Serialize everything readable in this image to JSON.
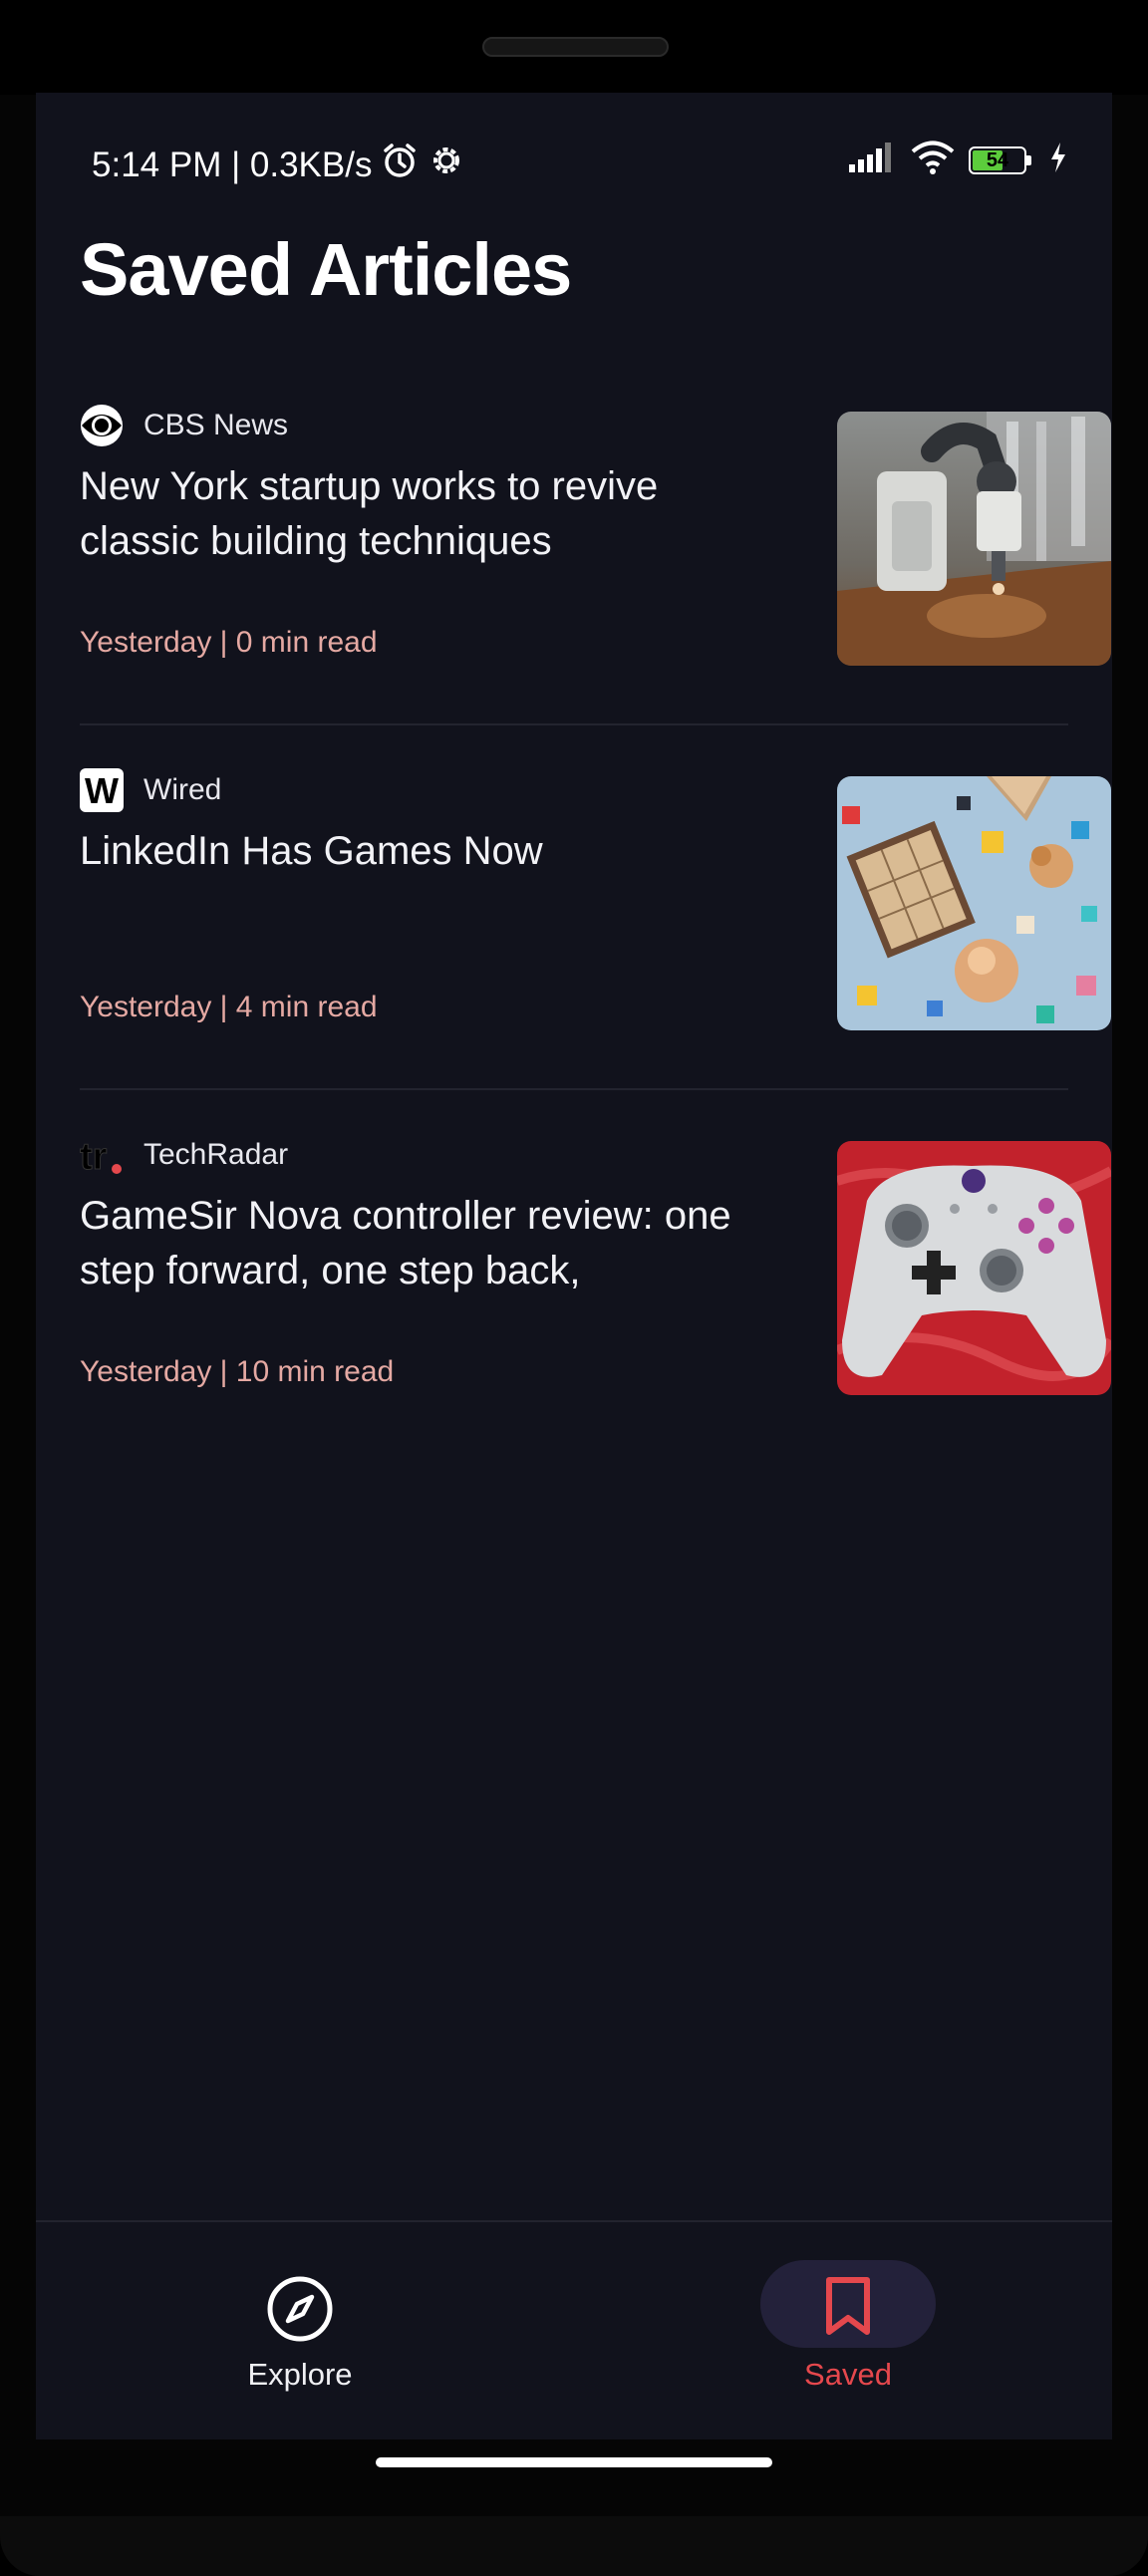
{
  "status_bar": {
    "time_speed": "5:14 PM | 0.3KB/s",
    "battery": "54"
  },
  "page_title": "Saved Articles",
  "articles": [
    {
      "source": "CBS News",
      "headline": "New York startup works to revive classic building techniques",
      "meta": "Yesterday | 0 min read"
    },
    {
      "source": "Wired",
      "headline": "LinkedIn Has Games Now",
      "meta": "Yesterday | 4 min read"
    },
    {
      "source": "TechRadar",
      "headline": "GameSir Nova controller review: one step forward, one step back,",
      "meta": "Yesterday | 10 min read"
    }
  ],
  "bottom_nav": {
    "explore_label": "Explore",
    "saved_label": "Saved"
  },
  "colors": {
    "background": "#11121c",
    "accent": "#e5484d",
    "meta_text": "#e5a9a3",
    "nav_pill": "#23213a"
  }
}
